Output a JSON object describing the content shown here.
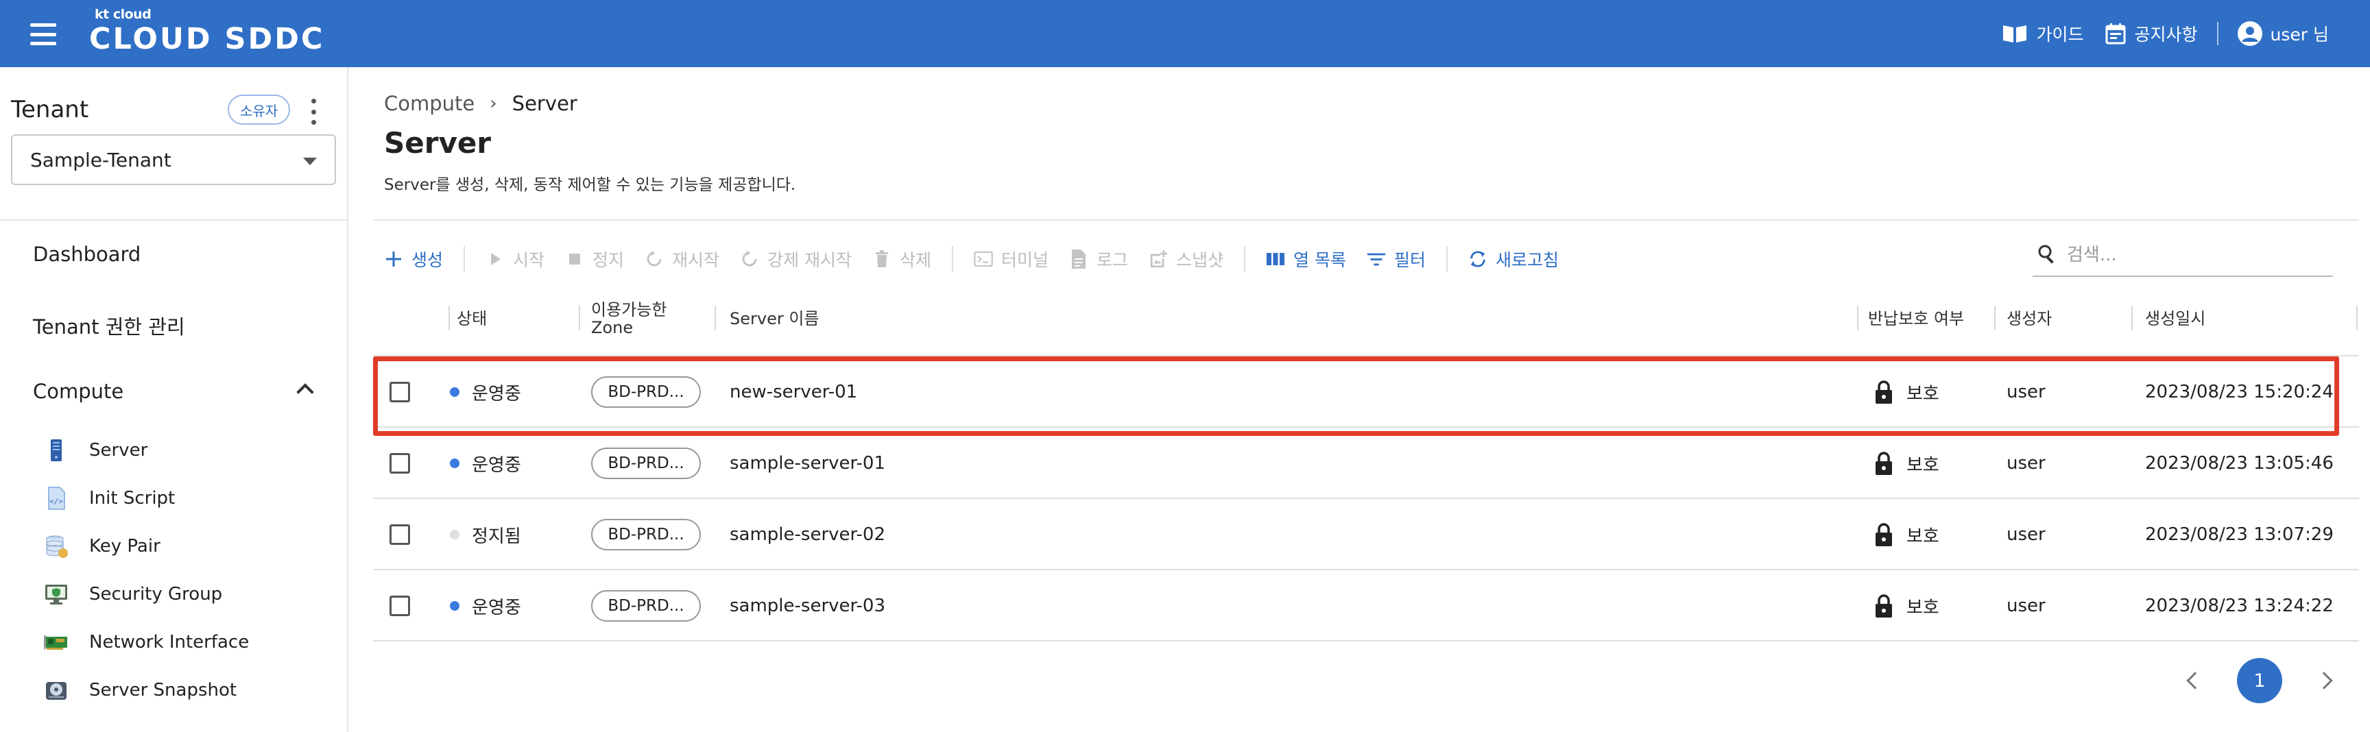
{
  "app": {
    "logo_small": "kt cloud",
    "logo_main": "CLOUD SDDC",
    "brand_color": "#2f6fc6"
  },
  "topbar": {
    "guide_label": "가이드",
    "notice_label": "공지사항",
    "user_label": "user 님"
  },
  "sidebar": {
    "tenant_heading": "Tenant",
    "owner_badge": "소유자",
    "tenant_selected": "Sample-Tenant",
    "nav": [
      {
        "label": "Dashboard"
      },
      {
        "label": "Tenant 권한 관리"
      },
      {
        "label": "Compute",
        "expanded": true
      }
    ],
    "compute_items": [
      {
        "label": "Server",
        "icon": "server-icon"
      },
      {
        "label": "Init Script",
        "icon": "script-file-icon"
      },
      {
        "label": "Key Pair",
        "icon": "database-icon"
      },
      {
        "label": "Security Group",
        "icon": "monitor-shield-icon"
      },
      {
        "label": "Network Interface",
        "icon": "network-card-icon"
      },
      {
        "label": "Server Snapshot",
        "icon": "disk-icon"
      }
    ]
  },
  "main": {
    "breadcrumb": [
      "Compute",
      "Server"
    ],
    "title": "Server",
    "description": "Server를 생성, 삭제, 동작 제어할 수 있는 기능을 제공합니다.",
    "toolbar": {
      "create": "생성",
      "start": "시작",
      "stop": "정지",
      "restart": "재시작",
      "force_restart": "강제 재시작",
      "delete": "삭제",
      "terminal": "터미널",
      "log": "로그",
      "snapshot": "스냅샷",
      "columns": "열 목록",
      "filter": "필터",
      "refresh": "새로고침"
    },
    "search_placeholder": "검색...",
    "table": {
      "headers": {
        "status": "상태",
        "zone_line1": "이용가능한",
        "zone_line2": "Zone",
        "name": "Server 이름",
        "protection": "반납보호 여부",
        "creator": "생성자",
        "created": "생성일시"
      },
      "rows": [
        {
          "status": "운영중",
          "status_color": "#3b7be0",
          "zone": "BD-PRD...",
          "name": "new-server-01",
          "protection": "보호",
          "creator": "user",
          "created": "2023/08/23 15:20:24"
        },
        {
          "status": "운영중",
          "status_color": "#3b7be0",
          "zone": "BD-PRD...",
          "name": "sample-server-01",
          "protection": "보호",
          "creator": "user",
          "created": "2023/08/23 13:05:46"
        },
        {
          "status": "정지됨",
          "status_color": "#e0e0e0",
          "zone": "BD-PRD...",
          "name": "sample-server-02",
          "protection": "보호",
          "creator": "user",
          "created": "2023/08/23 13:07:29"
        },
        {
          "status": "운영중",
          "status_color": "#3b7be0",
          "zone": "BD-PRD...",
          "name": "sample-server-03",
          "protection": "보호",
          "creator": "user",
          "created": "2023/08/23 13:24:22"
        }
      ]
    },
    "pagination": {
      "current_page": "1"
    },
    "highlight_color": "#e23b2a"
  }
}
